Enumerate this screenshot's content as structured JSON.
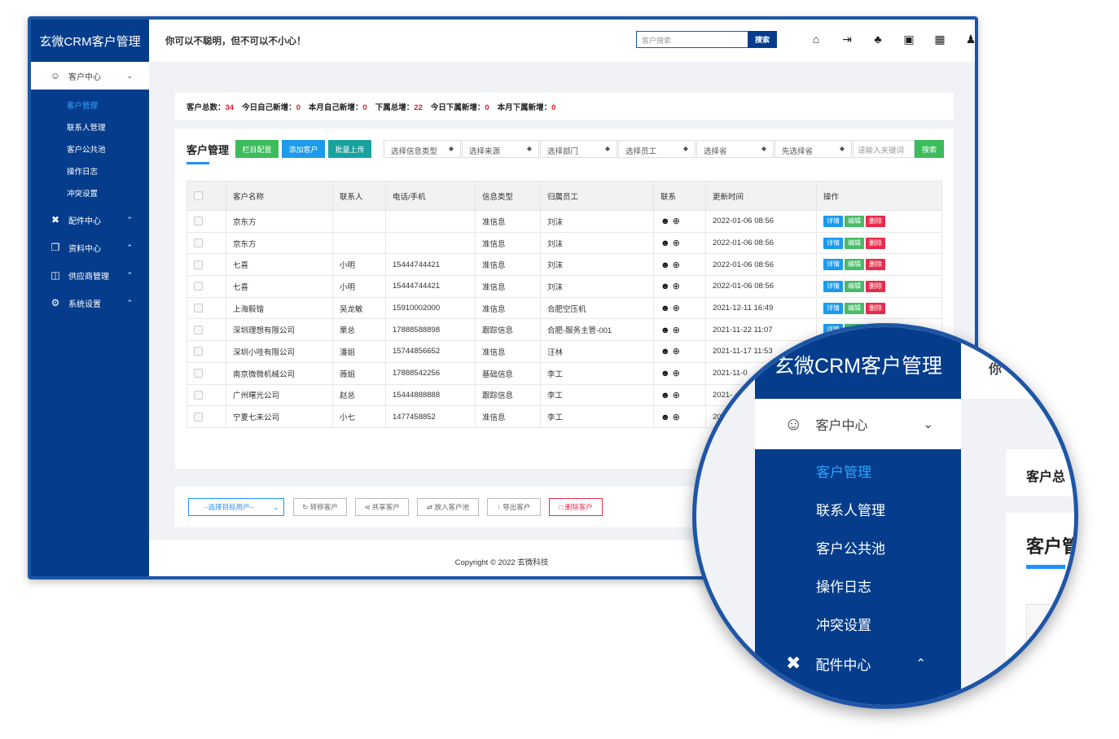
{
  "app": {
    "brand": "玄微CRM客户管理",
    "motto": "你可以不聪明，但不可以不小心！",
    "colors": {
      "primary": "#053d8c",
      "active": "#2fa3ff",
      "highlight": "#e02020"
    }
  },
  "search": {
    "placeholder": "客户搜索",
    "button": "搜索"
  },
  "top_icons": [
    "home-icon",
    "export-icon",
    "bell-icon",
    "qr-scan-icon",
    "qr-code-icon",
    "user-settings-icon"
  ],
  "sidebar": {
    "groups": [
      {
        "label": "客户中心",
        "icon": "user-icon",
        "expanded": true,
        "items": [
          "客户管理",
          "联系人管理",
          "客户公共池",
          "操作日志",
          "冲突设置"
        ],
        "active": "客户管理"
      },
      {
        "label": "配件中心",
        "icon": "parts-icon",
        "expanded": false
      },
      {
        "label": "资料中心",
        "icon": "docs-icon",
        "expanded": false
      },
      {
        "label": "供应商管理",
        "icon": "id-card-icon",
        "expanded": false
      },
      {
        "label": "系统设置",
        "icon": "gear-icon",
        "expanded": false
      }
    ]
  },
  "stats": [
    {
      "label": "客户总数：",
      "value": "34"
    },
    {
      "label": "今日自己新增：",
      "value": "0"
    },
    {
      "label": "本月自己新增：",
      "value": "0"
    },
    {
      "label": "下属总增：",
      "value": "22"
    },
    {
      "label": "今日下属新增：",
      "value": "0"
    },
    {
      "label": "本月下属新增：",
      "value": "0"
    }
  ],
  "card": {
    "title": "客户管理",
    "buttons": {
      "columns": "栏目配置",
      "add": "添加客户",
      "batch": "批量上传"
    },
    "filters": [
      "选择信息类型",
      "选择来源",
      "选择部门",
      "选择员工",
      "选择省",
      "先选择省"
    ],
    "keyword_placeholder": "请输入关键词",
    "search": "搜索"
  },
  "table": {
    "columns": [
      "客户名称",
      "联系人",
      "电话/手机",
      "信息类型",
      "归属员工",
      "联系",
      "更新时间",
      "操作"
    ],
    "actions": {
      "detail": "详情",
      "edit": "编辑",
      "delete": "删除"
    },
    "rows": [
      {
        "name": "京东方",
        "contact": "",
        "phone": "",
        "type": "准信息",
        "owner": "刘沫",
        "updated": "2022-01-06 08:56"
      },
      {
        "name": "京东方",
        "contact": "",
        "phone": "",
        "type": "准信息",
        "owner": "刘沫",
        "updated": "2022-01-06 08:56"
      },
      {
        "name": "七喜",
        "contact": "小明",
        "phone": "15444744421",
        "type": "准信息",
        "owner": "刘沫",
        "updated": "2022-01-06 08:56"
      },
      {
        "name": "七喜",
        "contact": "小明",
        "phone": "15444744421",
        "type": "准信息",
        "owner": "刘沫",
        "updated": "2022-01-06 08:56"
      },
      {
        "name": "上海毅锴",
        "contact": "吴龙敏",
        "phone": "15910002000",
        "type": "准信息",
        "owner": "合肥空压机",
        "updated": "2021-12-11 16:49"
      },
      {
        "name": "深圳理想有限公司",
        "contact": "栗总",
        "phone": "17888588898",
        "type": "跟踪信息",
        "owner": "合肥-服务主管-001",
        "updated": "2021-11-22 11:07"
      },
      {
        "name": "深圳小哇有限公司",
        "contact": "潘姐",
        "phone": "15744856652",
        "type": "准信息",
        "owner": "汪林",
        "updated": "2021-11-17 11:53"
      },
      {
        "name": "南京微微机械公司",
        "contact": "薇姐",
        "phone": "17888542256",
        "type": "基础信息",
        "owner": "李工",
        "updated": "2021-11-0"
      },
      {
        "name": "广州曙光公司",
        "contact": "赵总",
        "phone": "15444888888",
        "type": "跟踪信息",
        "owner": "李工",
        "updated": "2021-"
      },
      {
        "name": "宁夏七未公司",
        "contact": "小七",
        "phone": "1477458852",
        "type": "准信息",
        "owner": "李工",
        "updated": "20"
      }
    ]
  },
  "bottom": {
    "target_select": "--选择目标用户--",
    "transfer": "转移客户",
    "share": "共享客户",
    "to_pool": "放入客户池",
    "export": "导出客户",
    "delete": "删除客户"
  },
  "footer": {
    "copyright": "Copyright © 2022 玄微科技"
  },
  "magnifier": {
    "brand": "玄微CRM客户管理",
    "group": "客户中心",
    "items": [
      "客户管理",
      "联系人管理",
      "客户公共池",
      "操作日志",
      "冲突设置"
    ],
    "group2": "配件中心",
    "top_partial": "你",
    "stat_partial": "客户总",
    "card_partial": "客户管"
  }
}
